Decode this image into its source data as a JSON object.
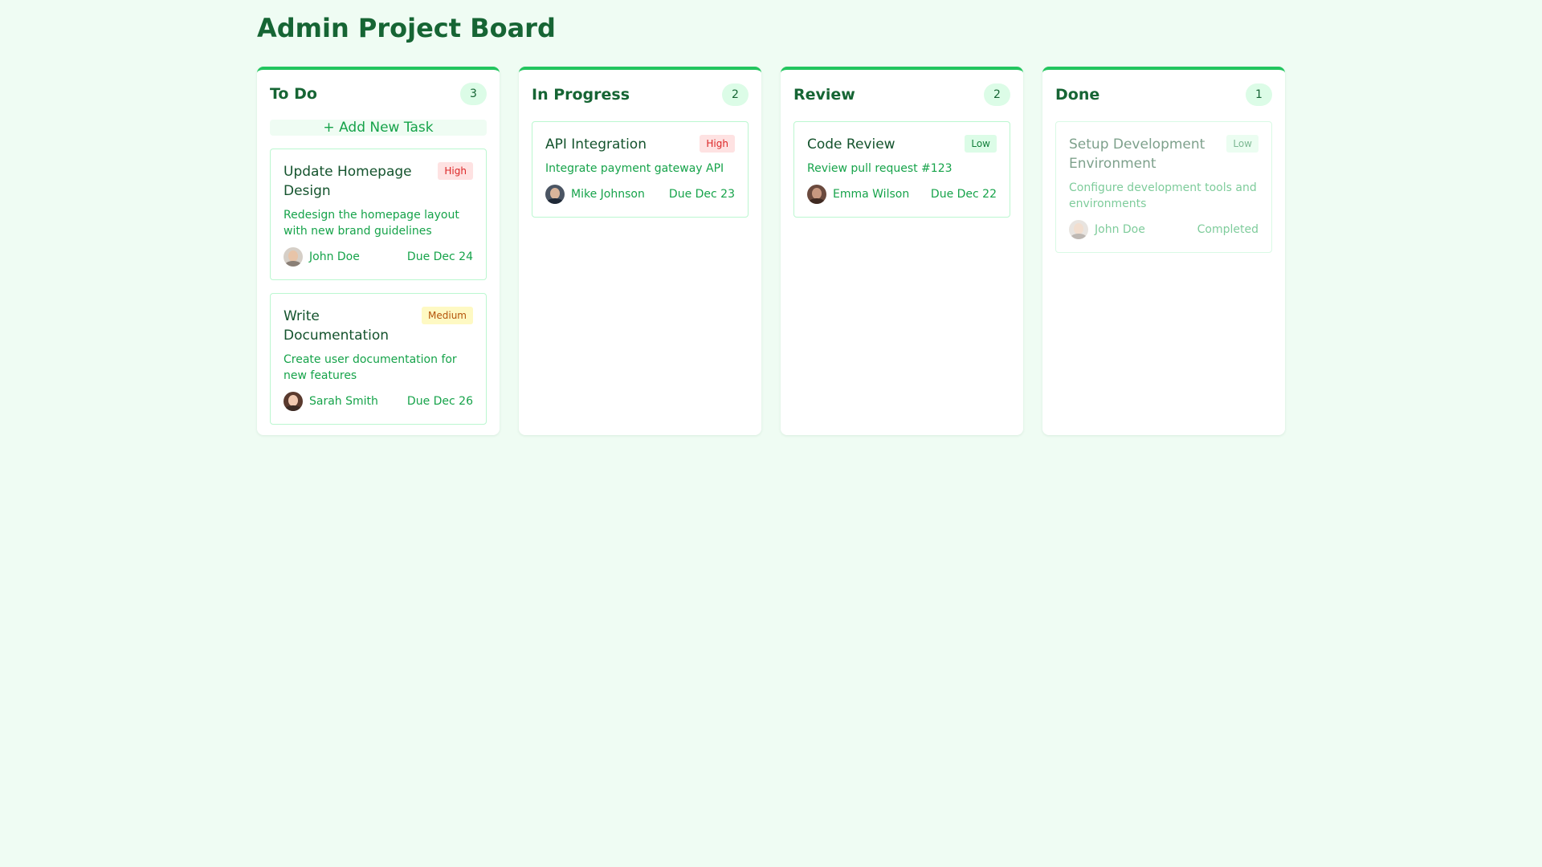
{
  "page": {
    "title": "Admin Project Board"
  },
  "columns": [
    {
      "title": "To Do",
      "count": "3",
      "add_label": "+ Add New Task",
      "cards": [
        {
          "title": "Update Homepage Design",
          "priority": "High",
          "description": "Redesign the homepage layout with new brand guidelines",
          "assignee": "John Doe",
          "due": "Due Dec 24"
        },
        {
          "title": "Write Documentation",
          "priority": "Medium",
          "description": "Create user documentation for new features",
          "assignee": "Sarah Smith",
          "due": "Due Dec 26"
        }
      ]
    },
    {
      "title": "In Progress",
      "count": "2",
      "cards": [
        {
          "title": "API Integration",
          "priority": "High",
          "description": "Integrate payment gateway API",
          "assignee": "Mike Johnson",
          "due": "Due Dec 23"
        }
      ]
    },
    {
      "title": "Review",
      "count": "2",
      "cards": [
        {
          "title": "Code Review",
          "priority": "Low",
          "description": "Review pull request #123",
          "assignee": "Emma Wilson",
          "due": "Due Dec 22"
        }
      ]
    },
    {
      "title": "Done",
      "count": "1",
      "cards": [
        {
          "title": "Setup Development Environment",
          "priority": "Low",
          "description": "Configure development tools and environments",
          "assignee": "John Doe",
          "due": "Completed"
        }
      ]
    }
  ],
  "colors": {
    "accent": "#22c55e",
    "background": "#effcf3",
    "text_primary": "#166534",
    "priority_high": "#dc2626",
    "priority_medium": "#b45309",
    "priority_low": "#15803d"
  }
}
